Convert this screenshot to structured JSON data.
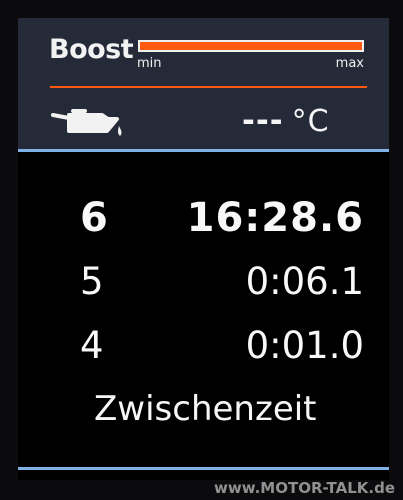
{
  "boost": {
    "label": "Boost",
    "min_label": "min",
    "max_label": "max",
    "color": "#ff5a10"
  },
  "oil": {
    "icon": "oil-can-icon",
    "value": "---",
    "unit": "°C"
  },
  "laps": [
    {
      "number": "6",
      "time": "16:28.6"
    },
    {
      "number": "5",
      "time": "0:06.1"
    },
    {
      "number": "4",
      "time": "0:01.0"
    }
  ],
  "caption": "Zwischenzeit",
  "watermark": "www.MOTOR-TALK.de",
  "colors": {
    "accent": "#ff5a10",
    "separator": "#7fb3e7",
    "panel": "#242a38"
  }
}
